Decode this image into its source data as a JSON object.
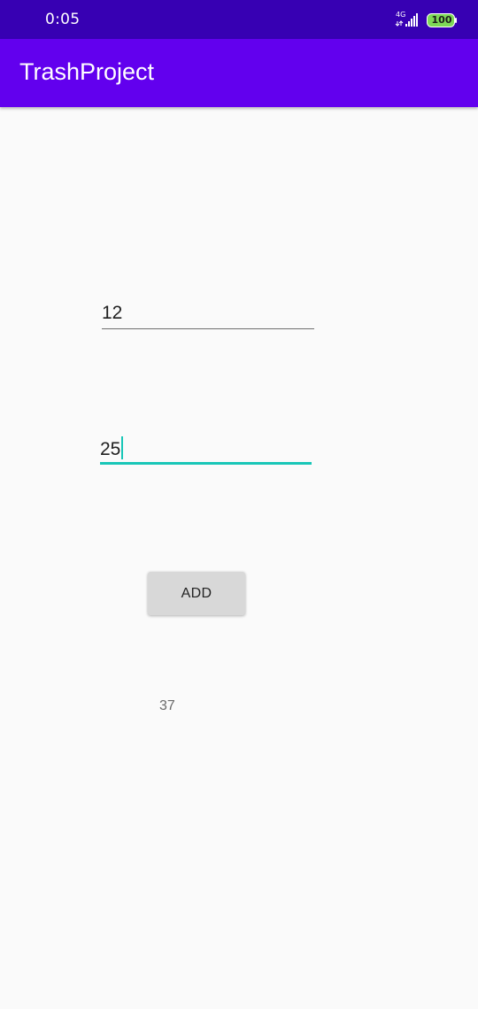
{
  "status_bar": {
    "time": "0:05",
    "network": "4G",
    "battery": "100"
  },
  "app_bar": {
    "title": "TrashProject"
  },
  "inputs": [
    {
      "value": "12"
    },
    {
      "value": "25"
    }
  ],
  "add_button": {
    "label": "ADD"
  },
  "result": {
    "value": "37"
  },
  "colors": {
    "status_bar": "#3700b3",
    "app_bar": "#6200ee",
    "accent": "#18c6b7",
    "background": "#fafafa"
  }
}
